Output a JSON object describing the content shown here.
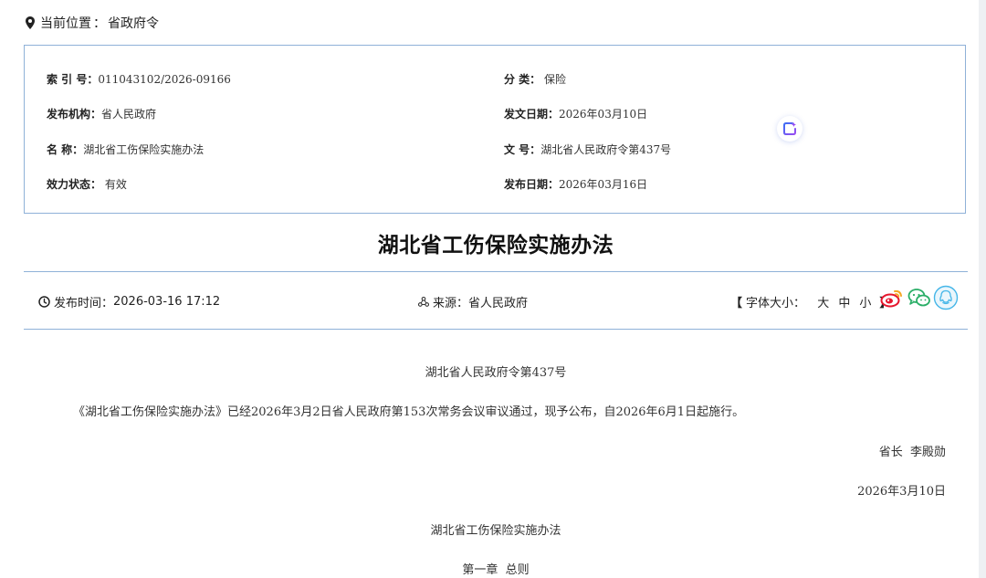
{
  "breadcrumb": {
    "label": "当前位置",
    "separator": "：",
    "current": "省政府令"
  },
  "info": {
    "index_label": "索 引 号：",
    "index_value": "011043102/2026-09166",
    "category_label": "分  类：",
    "category_value": "保险",
    "publisher_label": "发布机构：",
    "publisher_value": "省人民政府",
    "issue_date_label": "发文日期：",
    "issue_date_value": "2026年03月10日",
    "name_label": "名  称：",
    "name_value": "湖北省工伤保险实施办法",
    "doc_no_label": "文  号：",
    "doc_no_value": "湖北省人民政府令第437号",
    "status_label": "效力状态：",
    "status_value": "有效",
    "publish_date_label": "发布日期：",
    "publish_date_value": "2026年03月16日"
  },
  "title": "湖北省工伤保险实施办法",
  "meta": {
    "time_label": "发布时间：",
    "time_value": "2026-03-16 17:12",
    "source_label": "来源：",
    "source_value": "省人民政府",
    "font_open": "【",
    "font_label": "字体大小：",
    "font_large": "大",
    "font_medium": "中",
    "font_small": "小",
    "font_close": "】"
  },
  "body": {
    "order_no": "湖北省人民政府令第437号",
    "intro": "《湖北省工伤保险实施办法》已经2026年3月2日省人民政府第153次常务会议审议通过，现予公布，自2026年6月1日起施行。",
    "signature": "省长  李殿勋",
    "date": "2026年3月10日",
    "doc_title": "湖北省工伤保险实施办法",
    "chapter": "第一章  总则"
  },
  "colors": {
    "border": "#8fb1d8",
    "weibo": "#e6162d",
    "wechat": "#2aae67",
    "qq": "#45b6e8"
  }
}
